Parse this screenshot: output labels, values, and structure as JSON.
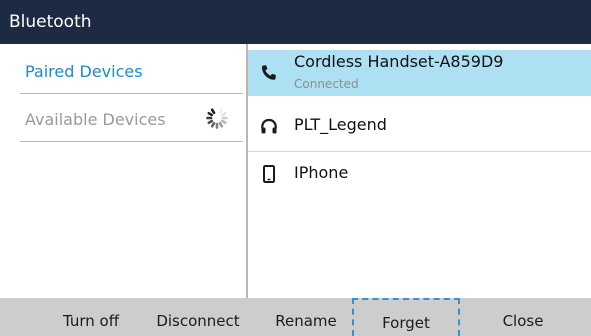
{
  "title": "Bluetooth",
  "sidebar": {
    "items": [
      {
        "label": "Paired Devices",
        "state": "selected"
      },
      {
        "label": "Available Devices",
        "state": "scanning"
      }
    ]
  },
  "devices": [
    {
      "name": "Cordless Handset-A859D9",
      "status": "Connected",
      "icon": "phone-handset-icon",
      "selected": true
    },
    {
      "name": "PLT_Legend",
      "icon": "headset-icon"
    },
    {
      "name": "IPhone",
      "icon": "mobile-phone-icon"
    }
  ],
  "softkeys": {
    "turn_off": "Turn off",
    "disconnect": "Disconnect",
    "rename": "Rename",
    "forget": "Forget",
    "close": "Close",
    "focused": "Forget"
  },
  "colors": {
    "titlebar": "#1c2b43",
    "accent": "#1a8ccf",
    "selected_row": "#aee0f3",
    "softkey_bar": "#cdcdcd"
  }
}
